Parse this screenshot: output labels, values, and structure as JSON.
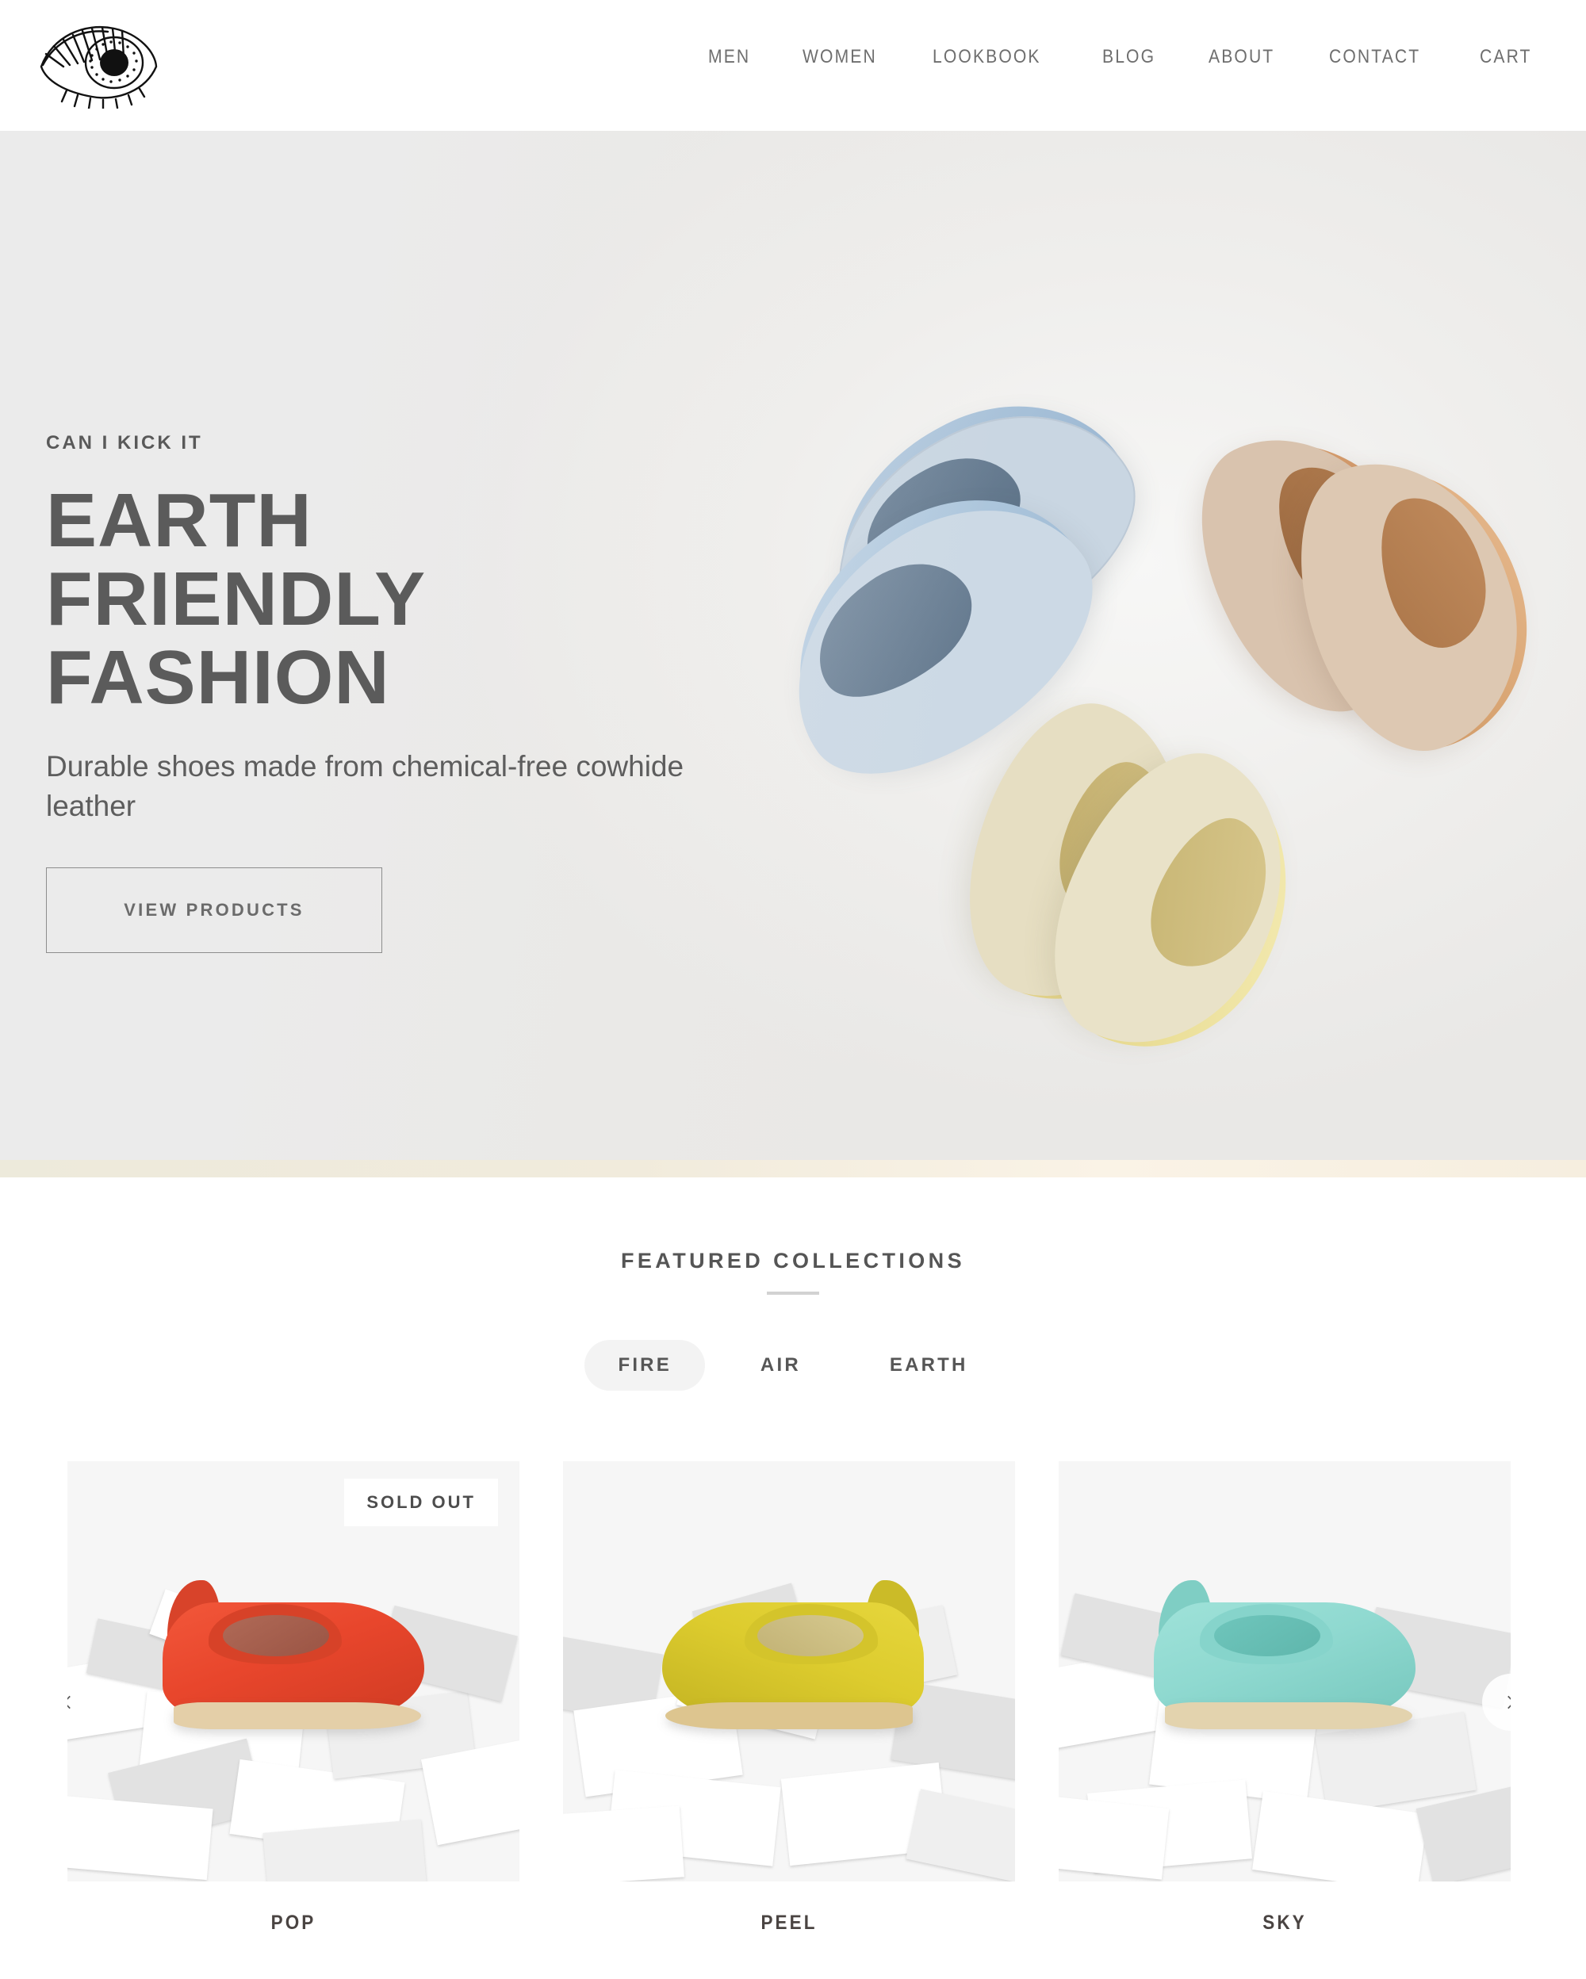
{
  "header": {
    "logo_name": "eye-logo",
    "nav": [
      {
        "label": "MEN"
      },
      {
        "label": "WOMEN"
      },
      {
        "label": "LOOKBOOK"
      },
      {
        "label": "BLOG"
      },
      {
        "label": "ABOUT"
      },
      {
        "label": "CONTACT"
      },
      {
        "label": "CART"
      }
    ]
  },
  "hero": {
    "eyebrow": "CAN I KICK IT",
    "title": "EARTH FRIENDLY FASHION",
    "subtitle": "Durable shoes made from chemical-free cowhide leather",
    "cta_label": "VIEW PRODUCTS",
    "background_color": "#ebebeb",
    "text_color": "#5b5b5b",
    "strip_color": "#f3eddd",
    "photo_alt": "Three pairs of leather slip-on loafers in light blue, tan and pale yellow arranged on a white surface"
  },
  "featured": {
    "title": "FEATURED COLLECTIONS",
    "tabs": [
      {
        "label": "FIRE",
        "active": true
      },
      {
        "label": "AIR",
        "active": false
      },
      {
        "label": "EARTH",
        "active": false
      }
    ],
    "prev_label": "chevron-left",
    "next_label": "chevron-right",
    "products": [
      {
        "name": "POP",
        "badge": "SOLD OUT",
        "shoe_color": "#e8462c",
        "shoe_color_dark": "#c93a22",
        "lining_color": "#a4604f",
        "sole_color": "#e4cfa8"
      },
      {
        "name": "PEEL",
        "badge": "",
        "shoe_color": "#ddcc2e",
        "shoe_color_dark": "#c4b423",
        "lining_color": "#cbbd86",
        "sole_color": "#ddc58f"
      },
      {
        "name": "SKY",
        "badge": "",
        "shoe_color": "#8fd9d0",
        "shoe_color_dark": "#74c5bc",
        "lining_color": "#6fc6bc",
        "sole_color": "#e3d3ae"
      }
    ]
  }
}
